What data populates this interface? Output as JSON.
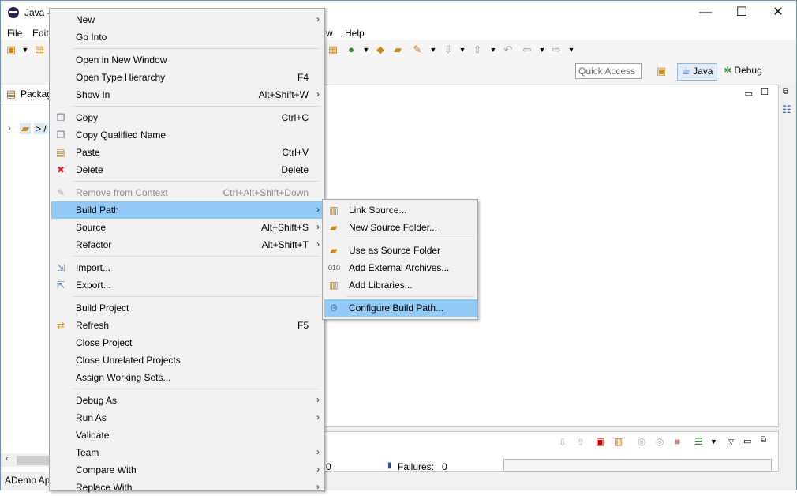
{
  "window": {
    "title": "Java -",
    "controls": {
      "minimize": "—",
      "maximize": "☐",
      "close": "✕"
    }
  },
  "menubar": [
    "File",
    "Edit",
    "w",
    "Help"
  ],
  "toolbar": {
    "quick_access_placeholder": "Quick Access",
    "perspectives": [
      {
        "label": "Java",
        "active": true
      },
      {
        "label": "Debug",
        "active": false
      }
    ]
  },
  "package_explorer": {
    "tab_label": "Packag",
    "tree_item": "> /"
  },
  "status_bar": {
    "text": "ADemo Ap"
  },
  "bottom_panel": {
    "failures_label": "Failures:",
    "failures_value": "0",
    "left_value": "0"
  },
  "context_menu": {
    "items": [
      {
        "label": "New",
        "shortcut": "",
        "submenu": true,
        "icon": ""
      },
      {
        "label": "Go Into",
        "shortcut": "",
        "submenu": false,
        "icon": ""
      },
      {
        "label": "Open in New Window",
        "shortcut": "",
        "submenu": false,
        "icon": ""
      },
      {
        "label": "Open Type Hierarchy",
        "shortcut": "F4",
        "submenu": false,
        "icon": ""
      },
      {
        "label": "Show In",
        "shortcut": "Alt+Shift+W",
        "submenu": true,
        "icon": ""
      },
      {
        "label": "Copy",
        "shortcut": "Ctrl+C",
        "submenu": false,
        "icon": "copy-icon"
      },
      {
        "label": "Copy Qualified Name",
        "shortcut": "",
        "submenu": false,
        "icon": "copy-qualified-icon"
      },
      {
        "label": "Paste",
        "shortcut": "Ctrl+V",
        "submenu": false,
        "icon": "paste-icon"
      },
      {
        "label": "Delete",
        "shortcut": "Delete",
        "submenu": false,
        "icon": "delete-icon"
      },
      {
        "label": "Remove from Context",
        "shortcut": "Ctrl+Alt+Shift+Down",
        "submenu": false,
        "icon": "remove-context-icon",
        "disabled": true
      },
      {
        "label": "Build Path",
        "shortcut": "",
        "submenu": true,
        "icon": "",
        "highlighted": true
      },
      {
        "label": "Source",
        "shortcut": "Alt+Shift+S",
        "submenu": true,
        "icon": ""
      },
      {
        "label": "Refactor",
        "shortcut": "Alt+Shift+T",
        "submenu": true,
        "icon": ""
      },
      {
        "label": "Import...",
        "shortcut": "",
        "submenu": false,
        "icon": "import-icon"
      },
      {
        "label": "Export...",
        "shortcut": "",
        "submenu": false,
        "icon": "export-icon"
      },
      {
        "label": "Build Project",
        "shortcut": "",
        "submenu": false,
        "icon": ""
      },
      {
        "label": "Refresh",
        "shortcut": "F5",
        "submenu": false,
        "icon": "refresh-icon"
      },
      {
        "label": "Close Project",
        "shortcut": "",
        "submenu": false,
        "icon": ""
      },
      {
        "label": "Close Unrelated Projects",
        "shortcut": "",
        "submenu": false,
        "icon": ""
      },
      {
        "label": "Assign Working Sets...",
        "shortcut": "",
        "submenu": false,
        "icon": ""
      },
      {
        "label": "Debug As",
        "shortcut": "",
        "submenu": true,
        "icon": ""
      },
      {
        "label": "Run As",
        "shortcut": "",
        "submenu": true,
        "icon": ""
      },
      {
        "label": "Validate",
        "shortcut": "",
        "submenu": false,
        "icon": ""
      },
      {
        "label": "Team",
        "shortcut": "",
        "submenu": true,
        "icon": ""
      },
      {
        "label": "Compare With",
        "shortcut": "",
        "submenu": true,
        "icon": ""
      },
      {
        "label": "Replace With",
        "shortcut": "",
        "submenu": true,
        "icon": ""
      }
    ]
  },
  "build_path_submenu": {
    "items": [
      {
        "label": "Link Source...",
        "icon": "link-source-icon"
      },
      {
        "label": "New Source Folder...",
        "icon": "new-source-folder-icon"
      },
      {
        "label": "Use as Source Folder",
        "icon": "use-source-folder-icon"
      },
      {
        "label": "Add External Archives...",
        "icon": "external-archive-icon"
      },
      {
        "label": "Add Libraries...",
        "icon": "libraries-icon"
      },
      {
        "label": "Configure Build Path...",
        "icon": "configure-build-path-icon",
        "highlighted": true
      }
    ]
  }
}
